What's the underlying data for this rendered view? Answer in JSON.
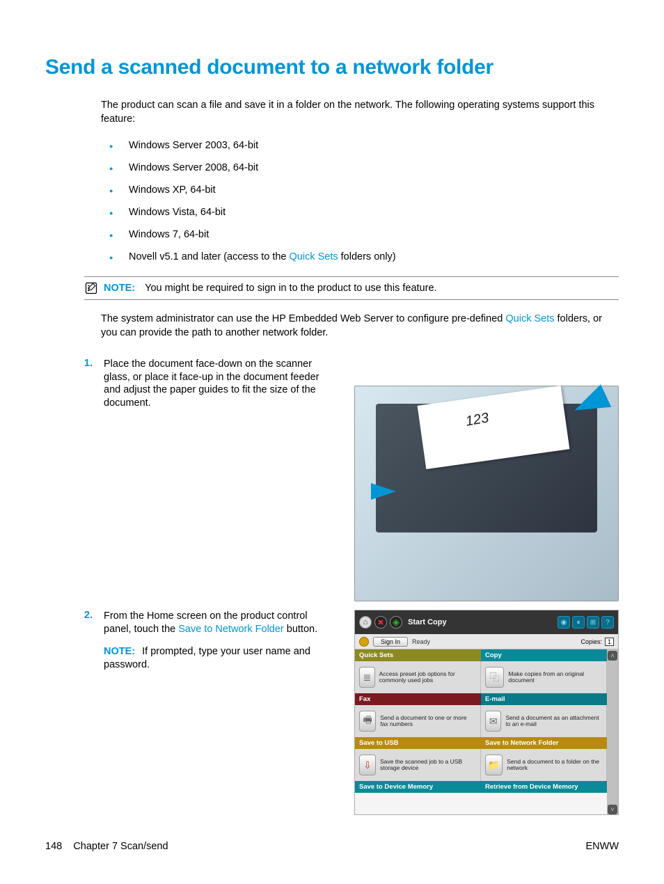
{
  "title": "Send a scanned document to a network folder",
  "intro": "The product can scan a file and save it in a folder on the network. The following operating systems support this feature:",
  "os": [
    "Windows Server 2003, 64-bit",
    "Windows Server 2008, 64-bit",
    "Windows XP, 64-bit",
    "Windows Vista, 64-bit",
    "Windows 7, 64-bit"
  ],
  "os_novell_pre": "Novell v5.1 and later (access to the ",
  "os_novell_link": "Quick Sets",
  "os_novell_post": " folders only)",
  "note": {
    "label": "NOTE:",
    "text": "You might be required to sign in to the product to use this feature."
  },
  "admin_para_pre": "The system administrator can use the HP Embedded Web Server to configure pre-defined ",
  "admin_para_link": "Quick Sets",
  "admin_para_post": " folders, or you can provide the path to another network folder.",
  "steps": {
    "s1": {
      "num": "1.",
      "text": "Place the document face-down on the scanner glass, or place it face-up in the document feeder and adjust the paper guides to fit the size of the document."
    },
    "s2": {
      "num": "2.",
      "text_pre": "From the Home screen on the product control panel, touch the ",
      "text_link": "Save to Network Folder",
      "text_post": " button.",
      "note_label": "NOTE:",
      "note_text": "If prompted, type your user name and password."
    }
  },
  "scanner": {
    "paper_label": "123"
  },
  "panel": {
    "start_copy": "Start Copy",
    "sign_in": "Sign In",
    "ready": "Ready",
    "copies_label": "Copies:",
    "copies_value": "1",
    "tiles": {
      "quicksets": {
        "title": "Quick Sets",
        "desc": "Access preset job options for commonly used jobs"
      },
      "copy": {
        "title": "Copy",
        "desc": "Make copies from an original document"
      },
      "fax": {
        "title": "Fax",
        "desc": "Send a document to one or more fax numbers"
      },
      "email": {
        "title": "E-mail",
        "desc": "Send a document as an attachment to an e-mail"
      },
      "usb": {
        "title": "Save to USB",
        "desc": "Save the scanned job to a USB storage device"
      },
      "netfolder": {
        "title": "Save to Network Folder",
        "desc": "Send a document to a folder on the network"
      },
      "devmem": {
        "title": "Save to Device Memory"
      },
      "retrieve": {
        "title": "Retrieve from Device Memory"
      }
    }
  },
  "footer": {
    "page": "148",
    "chapter": "Chapter 7   Scan/send",
    "lang": "ENWW"
  }
}
